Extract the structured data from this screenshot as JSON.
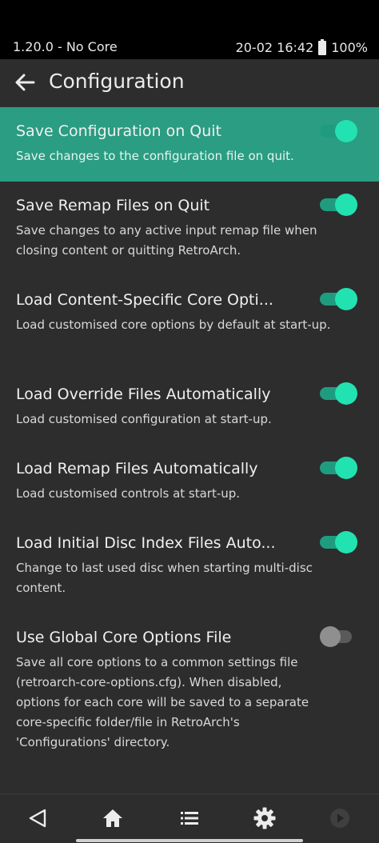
{
  "status_bar": {
    "left_text": "1.20.0 - No Core",
    "time": "20-02 16:42",
    "battery": "100%"
  },
  "header": {
    "title": "Configuration",
    "back_icon": "arrow-left-icon"
  },
  "settings": [
    {
      "title": "Save Configuration on Quit",
      "description": "Save changes to the configuration file on quit.",
      "enabled": true,
      "selected": true
    },
    {
      "title": "Save Remap Files on Quit",
      "description": "Save changes to any active input remap file when closing content or quitting RetroArch.",
      "enabled": true,
      "selected": false
    },
    {
      "title": "Load Content-Specific Core Opti...",
      "description": "Load customised core options by default at start-up.",
      "enabled": true,
      "selected": false
    },
    {
      "title": "Load Override Files Automatically",
      "description": "Load customised configuration at start-up.",
      "enabled": true,
      "selected": false
    },
    {
      "title": "Load Remap Files Automatically",
      "description": "Load customised controls at start-up.",
      "enabled": true,
      "selected": false
    },
    {
      "title": "Load Initial Disc Index Files Auto...",
      "description": "Change to last used disc when starting multi-disc content.",
      "enabled": true,
      "selected": false
    },
    {
      "title": "Use Global Core Options File",
      "description": "Save all core options to a common settings file (retroarch-core-options.cfg). When disabled, options for each core will be saved to a separate core-specific folder/file in RetroArch's 'Configurations' directory.",
      "enabled": false,
      "selected": false
    }
  ],
  "nav_bar": {
    "icons": [
      "back-triangle-icon",
      "home-icon",
      "menu-list-icon",
      "settings-gear-icon",
      "resume-play-icon"
    ]
  },
  "colors": {
    "accent": "#22e2b1",
    "selected_row": "#2a9d82",
    "background": "#2d2d2d"
  }
}
